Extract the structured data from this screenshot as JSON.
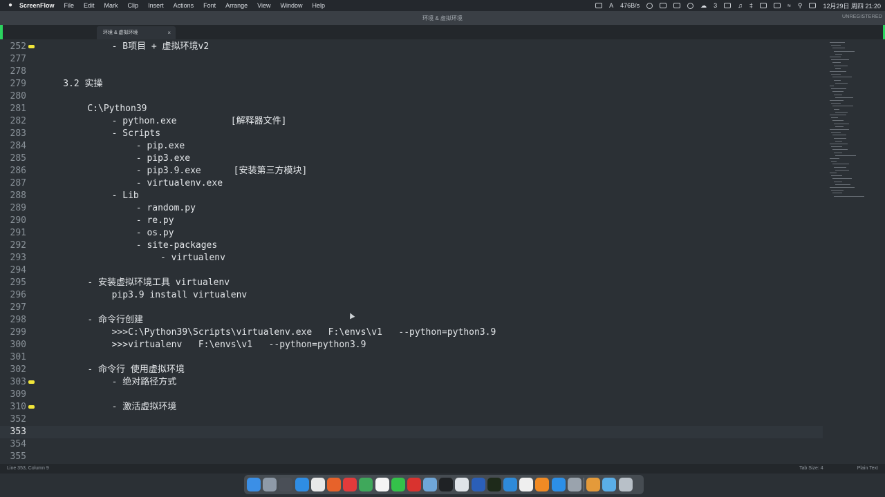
{
  "menubar": {
    "app_name": "ScreenFlow",
    "items": [
      "File",
      "Edit",
      "Mark",
      "Clip",
      "Insert",
      "Actions",
      "Font",
      "Arrange",
      "View",
      "Window",
      "Help"
    ],
    "status": {
      "network": "476B/s",
      "badge_count": "3",
      "datetime": "12月29日 周四  21:20"
    }
  },
  "window": {
    "title": "环境 & 虚拟环境",
    "unregistered": "UNREGISTERED",
    "tab_label": "环境 & 虚拟环境"
  },
  "editor": {
    "lines": [
      {
        "num": "252",
        "indent": 3,
        "text": "- B项目 + 虚拟环境v2",
        "fold": true
      },
      {
        "num": "277",
        "indent": 0,
        "text": ""
      },
      {
        "num": "278",
        "indent": 0,
        "text": ""
      },
      {
        "num": "279",
        "indent": 1,
        "text": "3.2 实操"
      },
      {
        "num": "280",
        "indent": 0,
        "text": ""
      },
      {
        "num": "281",
        "indent": 2,
        "text": "C:\\Python39"
      },
      {
        "num": "282",
        "indent": 3,
        "text": "- python.exe          [解释器文件]"
      },
      {
        "num": "283",
        "indent": 3,
        "text": "- Scripts"
      },
      {
        "num": "284",
        "indent": 4,
        "text": "- pip.exe"
      },
      {
        "num": "285",
        "indent": 4,
        "text": "- pip3.exe"
      },
      {
        "num": "286",
        "indent": 4,
        "text": "- pip3.9.exe      [安装第三方模块]"
      },
      {
        "num": "287",
        "indent": 4,
        "text": "- virtualenv.exe"
      },
      {
        "num": "288",
        "indent": 3,
        "text": "- Lib"
      },
      {
        "num": "289",
        "indent": 4,
        "text": "- random.py"
      },
      {
        "num": "290",
        "indent": 4,
        "text": "- re.py"
      },
      {
        "num": "291",
        "indent": 4,
        "text": "- os.py"
      },
      {
        "num": "292",
        "indent": 4,
        "text": "- site-packages"
      },
      {
        "num": "293",
        "indent": 5,
        "text": "- virtualenv"
      },
      {
        "num": "294",
        "indent": 0,
        "text": ""
      },
      {
        "num": "295",
        "indent": 2,
        "text": "- 安装虚拟环境工具 virtualenv"
      },
      {
        "num": "296",
        "indent": 3,
        "text": "pip3.9 install virtualenv"
      },
      {
        "num": "297",
        "indent": 0,
        "text": ""
      },
      {
        "num": "298",
        "indent": 2,
        "text": "- 命令行创建"
      },
      {
        "num": "299",
        "indent": 3,
        "text": ">>>C:\\Python39\\Scripts\\virtualenv.exe   F:\\envs\\v1   --python=python3.9"
      },
      {
        "num": "300",
        "indent": 3,
        "text": ">>>virtualenv   F:\\envs\\v1   --python=python3.9"
      },
      {
        "num": "301",
        "indent": 0,
        "text": ""
      },
      {
        "num": "302",
        "indent": 2,
        "text": "- 命令行 使用虚拟环境"
      },
      {
        "num": "303",
        "indent": 3,
        "text": "- 绝对路径方式",
        "fold": true
      },
      {
        "num": "309",
        "indent": 0,
        "text": ""
      },
      {
        "num": "310",
        "indent": 3,
        "text": "- 激活虚拟环境",
        "fold": true
      },
      {
        "num": "352",
        "indent": 0,
        "text": ""
      },
      {
        "num": "353",
        "indent": 0,
        "text": "",
        "active": true
      },
      {
        "num": "354",
        "indent": 0,
        "text": ""
      },
      {
        "num": "355",
        "indent": 0,
        "text": ""
      }
    ]
  },
  "statusbar": {
    "position": "Line 353, Column 9",
    "tab_size": "Tab Size: 4",
    "syntax": "Plain Text"
  },
  "dock": {
    "apps": [
      {
        "name": "finder",
        "color": "#3b8fe6"
      },
      {
        "name": "launchpad",
        "color": "#8e9aa8"
      },
      {
        "name": "mission-control",
        "color": "#4a4f57"
      },
      {
        "name": "safari",
        "color": "#2f8de4"
      },
      {
        "name": "chrome",
        "color": "#e8e8e8"
      },
      {
        "name": "firefox",
        "color": "#e7622a"
      },
      {
        "name": "app-red",
        "color": "#e23b3b"
      },
      {
        "name": "chrome-2",
        "color": "#3fa85b"
      },
      {
        "name": "calendar",
        "color": "#f4f4f4"
      },
      {
        "name": "wechat",
        "color": "#34c24a"
      },
      {
        "name": "netease-music",
        "color": "#d9332f"
      },
      {
        "name": "preview",
        "color": "#6fa6d8"
      },
      {
        "name": "terminal",
        "color": "#1f2225"
      },
      {
        "name": "text-edit",
        "color": "#dfe3e8"
      },
      {
        "name": "word",
        "color": "#2b5fb8"
      },
      {
        "name": "pycharm",
        "color": "#1e2a1a"
      },
      {
        "name": "vscode",
        "color": "#2e8ad8"
      },
      {
        "name": "typora",
        "color": "#efefef"
      },
      {
        "name": "sublime",
        "color": "#f08a24"
      },
      {
        "name": "qq",
        "color": "#2c8fe8"
      },
      {
        "name": "system-preferences",
        "color": "#9aa3ad"
      },
      {
        "name": "archive",
        "color": "#e49a3a"
      },
      {
        "name": "downloads-folder",
        "color": "#5aaee8"
      },
      {
        "name": "trash",
        "color": "#b8c0c8"
      }
    ]
  }
}
